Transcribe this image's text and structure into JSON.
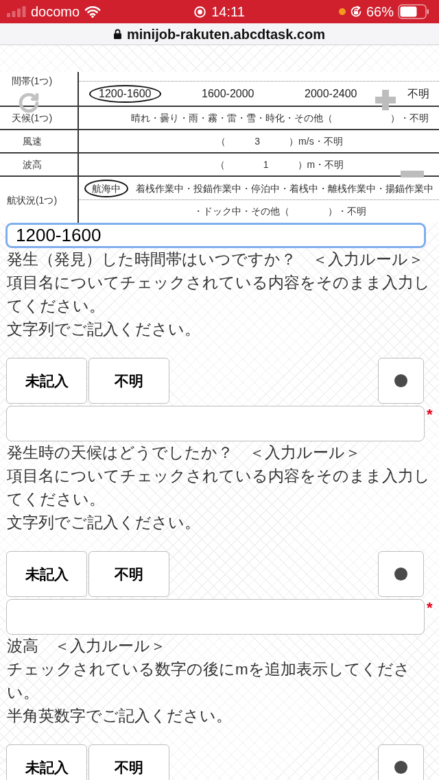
{
  "status_bar": {
    "carrier": "docomo",
    "time": "14:11",
    "battery": "66%"
  },
  "address_bar": {
    "url": "minijob-rakuten.abcdtask.com"
  },
  "document_image": {
    "rows": [
      {
        "kind": "choice",
        "label": "間帯(1つ)",
        "options": [
          {
            "label": "1200-1600",
            "selected": true
          },
          {
            "label": "1600-2000",
            "selected": false
          },
          {
            "label": "2000-2400",
            "selected": false
          },
          {
            "label": "不明",
            "selected": false
          }
        ]
      },
      {
        "kind": "text",
        "label": "天候(1つ)",
        "text": "晴れ・曇り・雨・霧・雷・雪・時化・その他（　　　　　　）・不明"
      },
      {
        "kind": "text",
        "label": "風速",
        "text": "（　　　3　　　）m/s・不明"
      },
      {
        "kind": "text",
        "label": "波高",
        "text": "（　　　　1　　　）m・不明"
      },
      {
        "kind": "choice_wrapped",
        "label": "航状況(1つ)",
        "options": [
          {
            "label": "航海中",
            "selected": true
          },
          {
            "label": "着桟作業中・投錨作業中・停泊中・着桟中・離桟作業中・揚錨作業中",
            "selected": false
          }
        ],
        "continuation": "・ドック中・その他（　　　　）・不明"
      }
    ]
  },
  "answer_field": {
    "value": "1200-1600",
    "focused": true
  },
  "questions": [
    {
      "question": "発生（発見）した時間帯はいつですか？　＜入力ルール＞",
      "rule": "項目名についてチェックされている内容をそのまま入力してください。",
      "format": "文字列でご記入ください。",
      "buttons": [
        "未記入",
        "不明"
      ],
      "answer": {
        "focused": false,
        "required_mark": "*"
      }
    },
    {
      "question": "発生時の天候はどうでしたか？　＜入力ルール＞",
      "rule": "項目名についてチェックされている内容をそのまま入力してください。",
      "format": "文字列でご記入ください。",
      "buttons": [
        "未記入",
        "不明"
      ],
      "answer": {
        "focused": false,
        "required_mark": "*"
      }
    },
    {
      "question": "波高　＜入力ルール＞",
      "rule": "チェックされている数字の後にmを追加表示してください。",
      "format": "半角英数字でご記入ください。",
      "buttons": [
        "未記入",
        "不明"
      ]
    }
  ]
}
